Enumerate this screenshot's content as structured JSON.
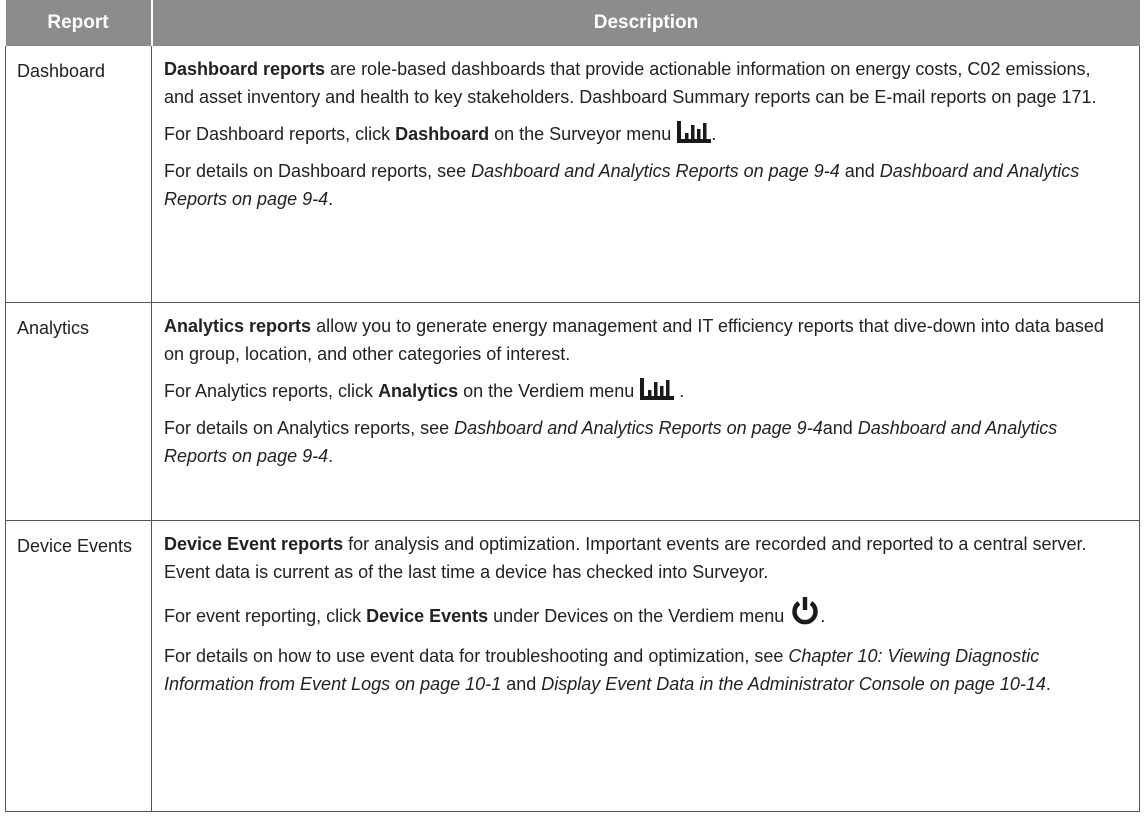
{
  "table": {
    "headers": [
      "Report",
      "Description"
    ],
    "rows": [
      {
        "report": "Dashboard",
        "p1_bold": "Dashboard reports",
        "p1_text": " are role-based dashboards that provide actionable information on energy costs, C02 emissions, and asset inventory and health to key stakeholders. Dashboard Summary reports can be E-mail reports on page 171.",
        "p2_pre": "For Dashboard reports, click ",
        "p2_bold": "Dashboard",
        "p2_post": " on the Surveyor menu ",
        "p2_end": ".",
        "p2_icon": "bar-chart-icon",
        "p3_pre": "For details on Dashboard reports, see ",
        "p3_i1": "Dashboard and Analytics Reports on page 9-4",
        "p3_mid": " and ",
        "p3_i2": "Dashboard and Analytics Reports on page 9-4",
        "p3_end": "."
      },
      {
        "report": "Analytics",
        "p1_bold": "Analytics reports",
        "p1_text": " allow you to generate energy management and IT efficiency reports that dive-down into data based on group, location, and other categories of interest.",
        "p2_pre": "For Analytics reports, click ",
        "p2_bold": "Analytics",
        "p2_post": " on the Verdiem menu ",
        "p2_end": " .",
        "p2_icon": "bar-chart-icon",
        "p3_pre": "For details on Analytics reports, see ",
        "p3_i1": "Dashboard and Analytics Reports on page 9-4",
        "p3_mid": "and ",
        "p3_i2": "Dashboard and Analytics Reports on page 9-4",
        "p3_end": "."
      },
      {
        "report": "Device Events",
        "p1_bold": "Device Event reports",
        "p1_text": " for analysis and optimization. Important events are recorded and reported to a central server. Event data is current as of the last time a device has checked into Surveyor.",
        "p2_pre": "For event reporting, click ",
        "p2_bold": "Device Events",
        "p2_post": " under Devices on the Verdiem menu ",
        "p2_end": ".",
        "p2_icon": "power-icon",
        "p3_pre": "For details on how to use event data for troubleshooting and optimization, see ",
        "p3_i1": "Chapter 10: Viewing Diagnostic Information from Event Logs on page 10-1",
        "p3_mid": " and ",
        "p3_i2": "Display Event Data in the Administrator Console on page 10-14",
        "p3_end": "."
      }
    ]
  }
}
